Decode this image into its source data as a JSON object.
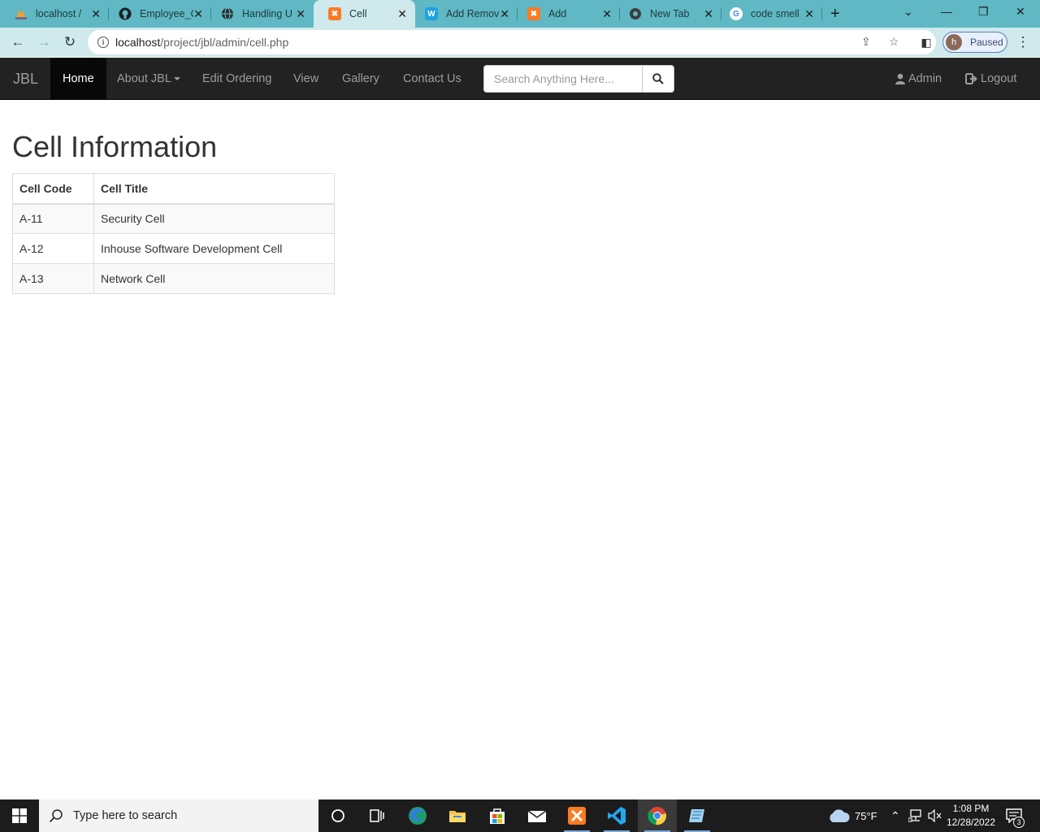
{
  "browser": {
    "tabs": [
      {
        "title": "localhost /",
        "icon": "phpmyadmin-icon"
      },
      {
        "title": "Employee_C",
        "icon": "github-icon"
      },
      {
        "title": "Handling U",
        "icon": "globe-icon"
      },
      {
        "title": "Cell",
        "icon": "xampp-icon",
        "active": true
      },
      {
        "title": "Add Remov",
        "icon": "word-icon"
      },
      {
        "title": "Add",
        "icon": "xampp-icon"
      },
      {
        "title": "New Tab",
        "icon": "chrome-icon"
      },
      {
        "title": "code smell",
        "icon": "google-icon"
      }
    ],
    "url_host": "localhost",
    "url_path": "/project/jbl/admin/cell.php",
    "profile_initial": "h",
    "profile_status": "Paused"
  },
  "navbar": {
    "brand": "JBL",
    "items": [
      "Home",
      "About JBL",
      "Edit Ordering",
      "View",
      "Gallery",
      "Contact Us"
    ],
    "active_item": "Home",
    "search_placeholder": "Search Anything Here...",
    "user_label": "Admin",
    "logout_label": "Logout"
  },
  "content": {
    "title": "Cell Information",
    "table": {
      "headers": [
        "Cell Code",
        "Cell Title"
      ],
      "rows": [
        [
          "A-11",
          "Security Cell"
        ],
        [
          "A-12",
          "Inhouse Software Development Cell"
        ],
        [
          "A-13",
          "Network Cell"
        ]
      ]
    }
  },
  "taskbar": {
    "search_placeholder": "Type here to search",
    "weather": "75°F",
    "time": "1:08 PM",
    "date": "12/28/2022",
    "notification_count": "3"
  },
  "colors": {
    "tab_strip": "#5fb8c3",
    "toolbar": "#cfe9ec",
    "navbar": "#222222",
    "navbar_active": "#080808",
    "taskbar": "#1c1c1c"
  }
}
